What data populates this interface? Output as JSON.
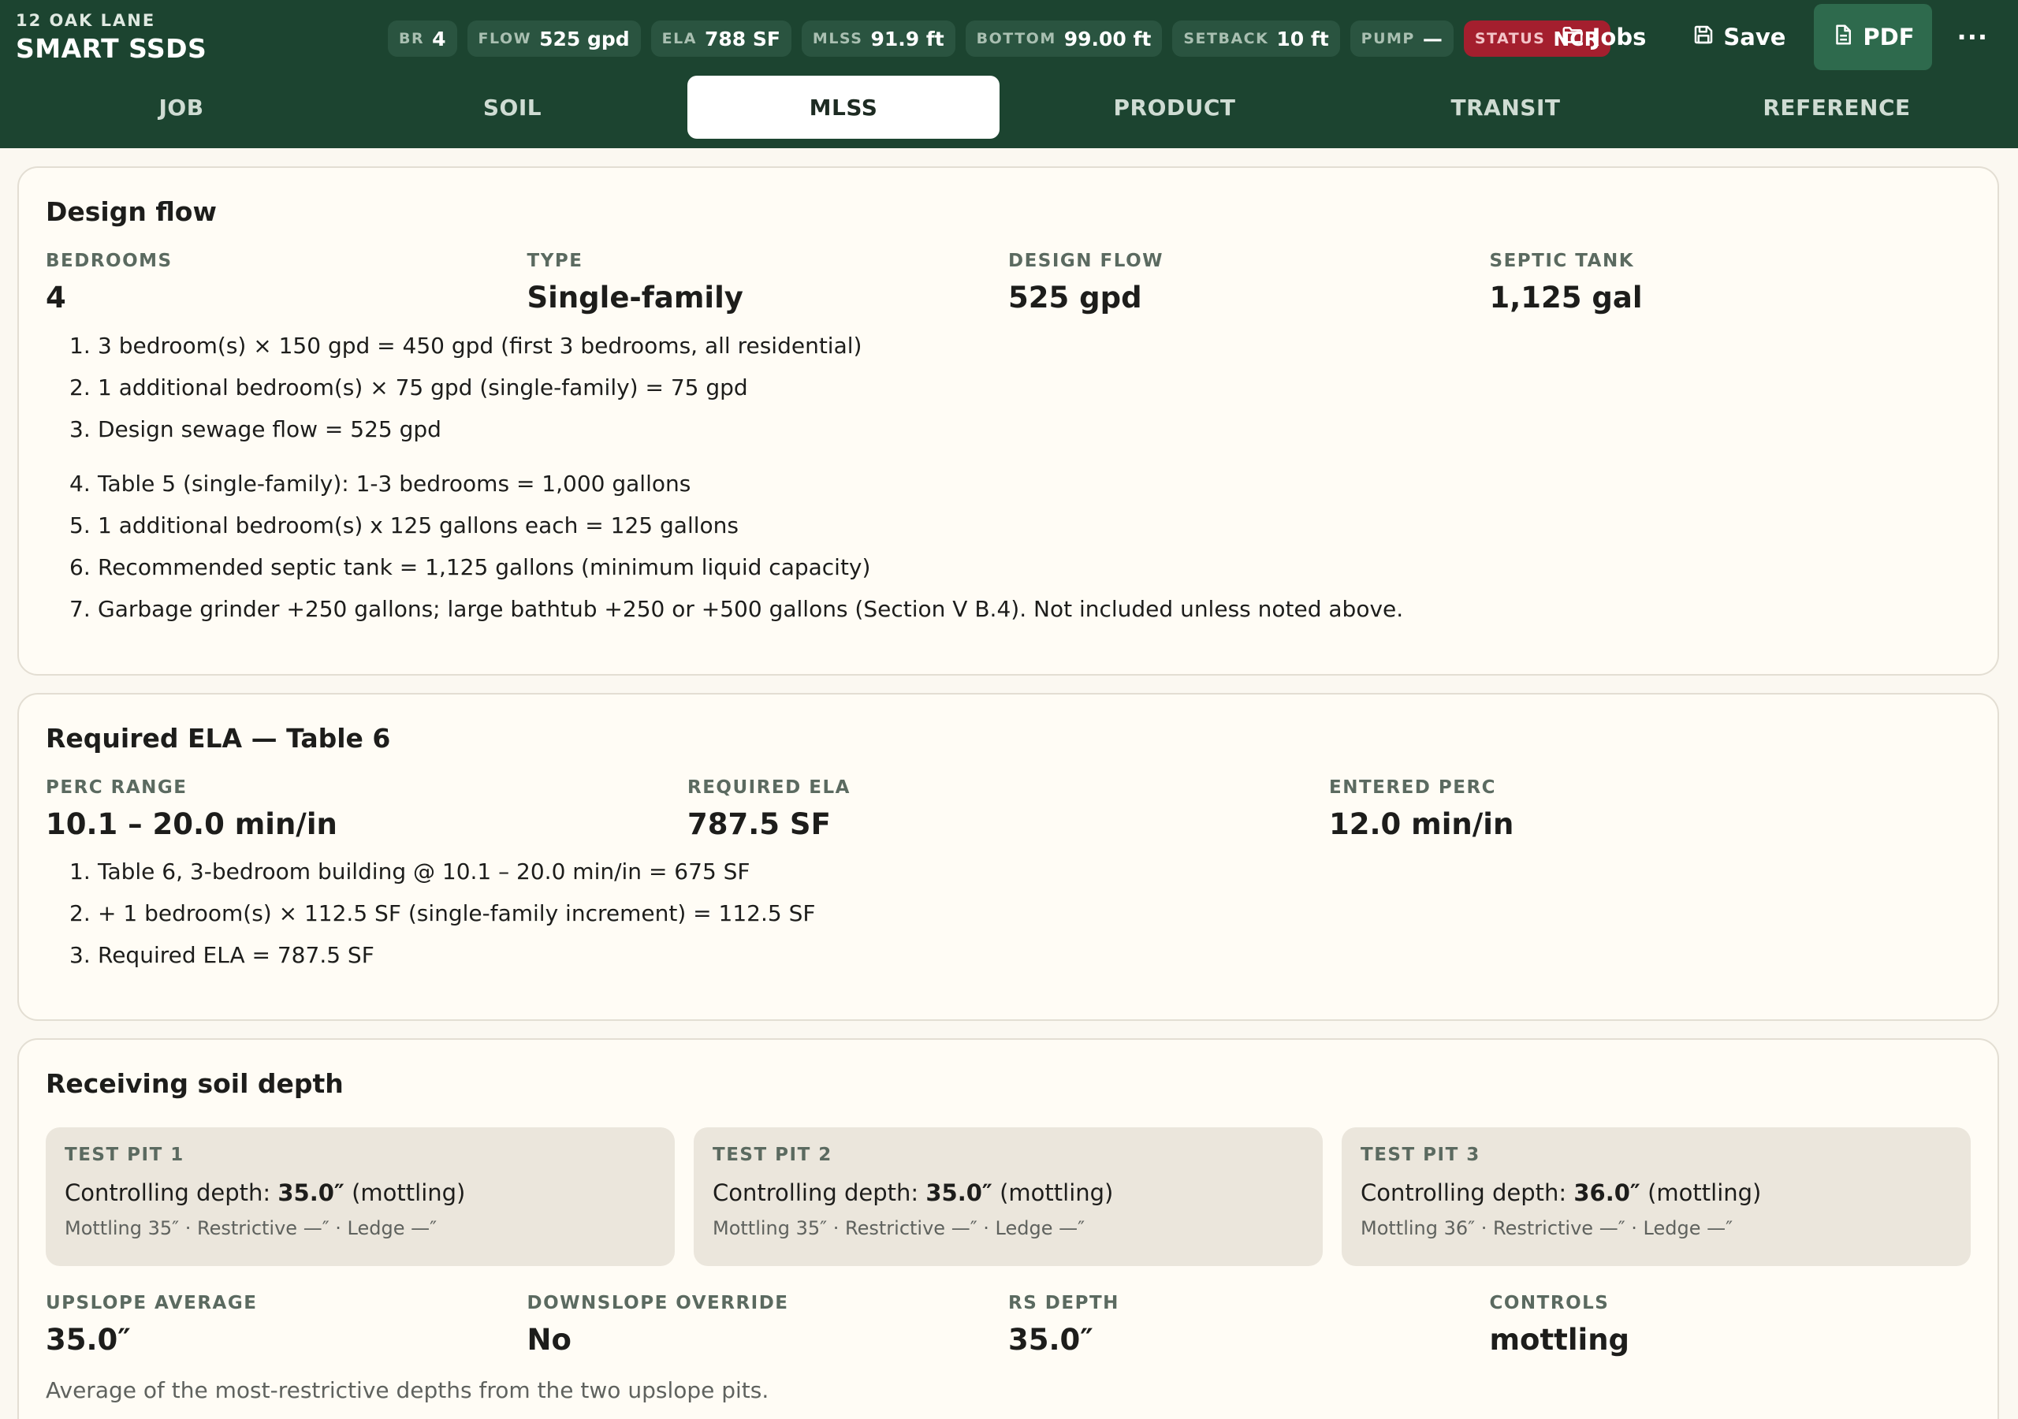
{
  "header": {
    "job_address": "12 OAK LANE",
    "app_name": "SMART SSDS",
    "chips": [
      {
        "key": "BR",
        "value": "4"
      },
      {
        "key": "FLOW",
        "value": "525 gpd"
      },
      {
        "key": "ELA",
        "value": "788 SF"
      },
      {
        "key": "MLSS",
        "value": "91.9 ft"
      },
      {
        "key": "BOTTOM",
        "value": "99.00 ft"
      },
      {
        "key": "SETBACK",
        "value": "10 ft"
      },
      {
        "key": "PUMP",
        "value": "—"
      },
      {
        "key": "STATUS",
        "value": "NCR"
      }
    ],
    "actions": {
      "jobs": "Jobs",
      "save": "Save",
      "pdf": "PDF",
      "more": "···"
    },
    "colors": {
      "bar": "#1c4430",
      "status_alert": "#a41f2e",
      "pdf_button": "#2e6a4d"
    }
  },
  "tabs": [
    {
      "label": "JOB"
    },
    {
      "label": "SOIL"
    },
    {
      "label": "MLSS",
      "active": true
    },
    {
      "label": "PRODUCT"
    },
    {
      "label": "TRANSIT"
    },
    {
      "label": "REFERENCE"
    }
  ],
  "design_flow": {
    "title": "Design flow",
    "stats": [
      {
        "label": "BEDROOMS",
        "value": "4"
      },
      {
        "label": "TYPE",
        "value": "Single-family"
      },
      {
        "label": "DESIGN FLOW",
        "value": "525 gpd"
      },
      {
        "label": "SEPTIC TANK",
        "value": "1,125 gal"
      }
    ],
    "flow_steps": [
      {
        "n": "1.",
        "text": "3 bedroom(s) × 150 gpd = 450 gpd (first 3 bedrooms, all residential)"
      },
      {
        "n": "2.",
        "text": "1 additional bedroom(s) × 75 gpd (single-family) = 75 gpd"
      },
      {
        "n": "3.",
        "text": "Design sewage flow = 525 gpd"
      }
    ],
    "tank_steps": [
      {
        "n": "4.",
        "text": "Table 5 (single-family): 1-3 bedrooms = 1,000 gallons"
      },
      {
        "n": "5.",
        "text": "1 additional bedroom(s) x 125 gallons each = 125 gallons"
      },
      {
        "n": "6.",
        "text": "Recommended septic tank = 1,125 gallons (minimum liquid capacity)"
      },
      {
        "n": "7.",
        "text": "Garbage grinder +250 gallons; large bathtub +250 or +500 gallons (Section V B.4). Not included unless noted above."
      }
    ]
  },
  "ela": {
    "title": "Required ELA — Table 6",
    "stats": [
      {
        "label": "PERC RANGE",
        "value": "10.1 – 20.0 min/in"
      },
      {
        "label": "REQUIRED ELA",
        "value": "787.5 SF"
      },
      {
        "label": "ENTERED PERC",
        "value": "12.0 min/in"
      }
    ],
    "steps": [
      {
        "n": "1.",
        "text": "Table 6, 3-bedroom building @ 10.1 – 20.0 min/in = 675 SF"
      },
      {
        "n": "2.",
        "text": "+ 1 bedroom(s) × 112.5 SF (single-family increment) = 112.5 SF"
      },
      {
        "n": "3.",
        "text": "Required ELA = 787.5 SF"
      }
    ]
  },
  "soil_depth": {
    "title": "Receiving soil depth",
    "pits": [
      {
        "title": "TEST PIT 1",
        "prefix": "Controlling depth:",
        "depth": "35.0″",
        "cause": "(mottling)",
        "detail": "Mottling 35″ · Restrictive —″ · Ledge —″"
      },
      {
        "title": "TEST PIT 2",
        "prefix": "Controlling depth:",
        "depth": "35.0″",
        "cause": "(mottling)",
        "detail": "Mottling 35″ · Restrictive —″ · Ledge —″"
      },
      {
        "title": "TEST PIT 3",
        "prefix": "Controlling depth:",
        "depth": "36.0″",
        "cause": "(mottling)",
        "detail": "Mottling 36″ · Restrictive —″ · Ledge —″"
      }
    ],
    "stats": [
      {
        "label": "UPSLOPE AVERAGE",
        "value": "35.0″"
      },
      {
        "label": "DOWNSLOPE OVERRIDE",
        "value": "No"
      },
      {
        "label": "RS DEPTH",
        "value": "35.0″"
      },
      {
        "label": "CONTROLS",
        "value": "mottling"
      }
    ],
    "note": "Average of the most-restrictive depths from the two upslope pits."
  }
}
